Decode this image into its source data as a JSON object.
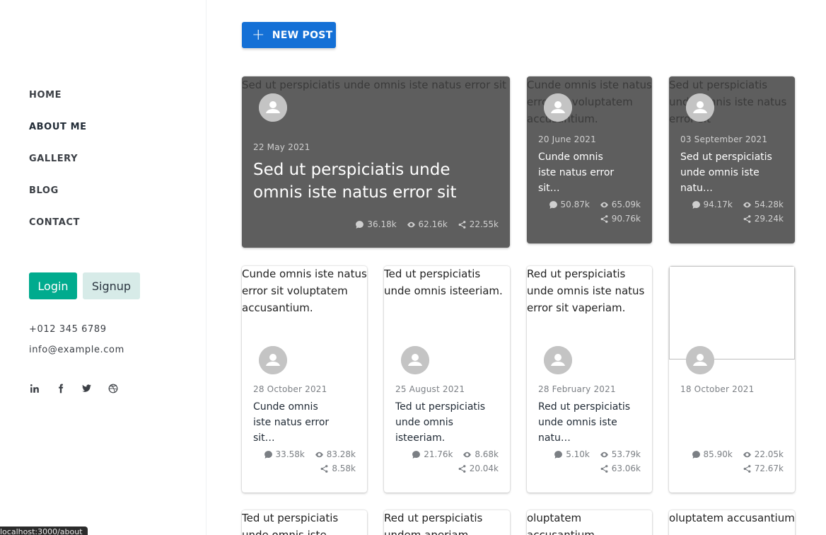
{
  "nav": {
    "items": [
      {
        "label": "HOME"
      },
      {
        "label": "ABOUT ME"
      },
      {
        "label": "GALLERY"
      },
      {
        "label": "BLOG"
      },
      {
        "label": "CONTACT"
      }
    ]
  },
  "auth": {
    "login": "Login",
    "signup": "Signup"
  },
  "contact": {
    "phone": "+012 345 6789",
    "email": "info@example.com"
  },
  "status_bar": {
    "url": "localhost:3000/about"
  },
  "toolbar": {
    "new_post": "NEW POST"
  },
  "featured": [
    {
      "alt": "Sed ut perspiciatis unde omnis iste natus error sit",
      "date": "22 May 2021",
      "title": "Sed ut perspiciatis unde omnis iste natus error sit",
      "comments": "36.18k",
      "views": "62.16k",
      "shares": "22.55k"
    },
    {
      "alt": "Cunde omnis iste natus error sit voluptatem accusantium.",
      "date": "20 June 2021",
      "title": "Cunde omnis iste natus error sit…",
      "comments": "50.87k",
      "views": "65.09k",
      "shares": "90.76k"
    },
    {
      "alt": "Sed ut perspiciatis unde omnis iste natus error sit",
      "date": "03 September 2021",
      "title": "Sed ut perspiciatis unde omnis iste natu…",
      "comments": "94.17k",
      "views": "54.28k",
      "shares": "29.24k"
    }
  ],
  "posts": [
    {
      "alt": "Cunde omnis iste natus error sit voluptatem accusantium.",
      "date": "28 October 2021",
      "title": "Cunde omnis iste natus error sit…",
      "comments": "33.58k",
      "views": "83.28k",
      "shares": "8.58k"
    },
    {
      "alt": "Ted ut perspiciatis unde omnis isteeriam.",
      "date": "25 August 2021",
      "title": "Ted ut perspiciatis unde omnis isteeriam.",
      "comments": "21.76k",
      "views": "8.68k",
      "shares": "20.04k"
    },
    {
      "alt": "Red ut perspiciatis unde omnis iste natus error sit vaperiam.",
      "date": "28 February 2021",
      "title": "Red ut perspiciatis unde omnis iste natu…",
      "comments": "5.10k",
      "views": "53.79k",
      "shares": "63.06k"
    },
    {
      "alt": "",
      "date": "18 October 2021",
      "title": "",
      "comments": "85.90k",
      "views": "22.05k",
      "shares": "72.67k"
    }
  ],
  "bottom_row": [
    {
      "alt": "Ted ut perspiciatis unde omnis iste"
    },
    {
      "alt": "Red ut perspiciatis undem aperiam"
    },
    {
      "alt": "oluptatem accusantium"
    },
    {
      "alt": "oluptatem accusantium"
    }
  ]
}
